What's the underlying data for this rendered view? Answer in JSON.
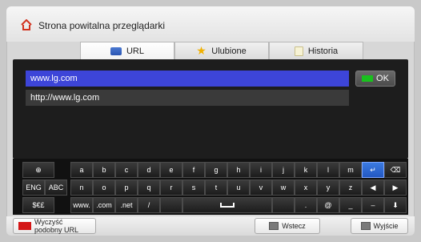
{
  "window": {
    "title": "Strona powitalna przeglądarki"
  },
  "tabs": [
    {
      "label": "URL",
      "icon": "url-icon",
      "active": true
    },
    {
      "label": "Ulubione",
      "icon": "star-icon",
      "active": false
    },
    {
      "label": "Historia",
      "icon": "history-icon",
      "active": false
    }
  ],
  "suggestions": [
    {
      "text": "www.lg.com",
      "selected": true
    },
    {
      "text": "http://www.lg.com",
      "selected": false
    }
  ],
  "ok_button": {
    "label": "OK"
  },
  "keyboard": {
    "row1": [
      "⊕",
      "a",
      "b",
      "c",
      "d",
      "e",
      "f",
      "g",
      "h",
      "i",
      "j",
      "k",
      "l",
      "m",
      "↵",
      "⌫"
    ],
    "row2": [
      "ENG",
      "ABC",
      "n",
      "o",
      "p",
      "q",
      "r",
      "s",
      "t",
      "u",
      "v",
      "w",
      "x",
      "y",
      "z",
      "◀",
      "▶"
    ],
    "row3": [
      "$€£",
      "www.",
      ".com",
      ".net",
      "/",
      "",
      "␣",
      "",
      ".",
      "@",
      "_",
      "–",
      "⬇"
    ]
  },
  "bottom": {
    "clear_label": "Wyczyść\npodobny URL",
    "back_label": "Wstecz",
    "exit_label": "Wyjście"
  }
}
